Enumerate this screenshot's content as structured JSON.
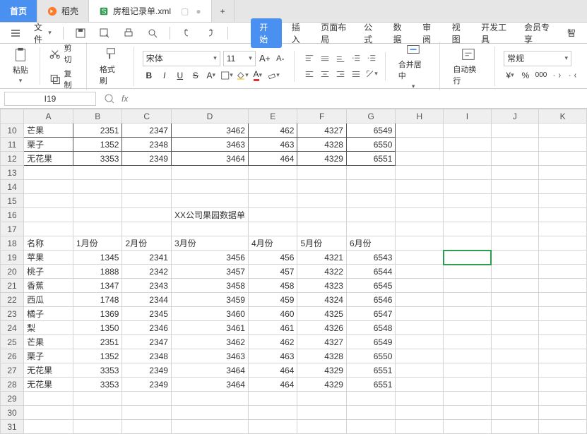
{
  "tabs": {
    "home": "首页",
    "daoke": "稻壳",
    "file": "房租记录单.xml"
  },
  "menu": {
    "file": "文件",
    "start": "开始",
    "insert": "插入",
    "page": "页面布局",
    "formula": "公式",
    "data": "数据",
    "review": "审阅",
    "view": "视图",
    "dev": "开发工具",
    "member": "会员专享",
    "smart": "智"
  },
  "clip": {
    "cut": "剪切",
    "copy": "复制",
    "paste": "粘贴",
    "brush": "格式刷"
  },
  "font": {
    "name": "宋体",
    "size": "11"
  },
  "align": {
    "merge": "合并居中",
    "wrap": "自动换行"
  },
  "numfmt": "常规",
  "cellref": "I19",
  "cols": [
    "A",
    "B",
    "C",
    "D",
    "E",
    "F",
    "G",
    "H",
    "I",
    "J",
    "K"
  ],
  "rows": [
    10,
    11,
    12,
    13,
    14,
    15,
    16,
    17,
    18,
    19,
    20,
    21,
    22,
    23,
    24,
    25,
    26,
    27,
    28,
    29,
    30,
    31
  ],
  "title": "XX公司果园数据单",
  "headers": {
    "name": "名称",
    "m1": "1月份",
    "m2": "2月份",
    "m3": "3月份",
    "m4": "4月份",
    "m5": "5月份",
    "m6": "6月份"
  },
  "top": [
    {
      "name": "芒果",
      "v": [
        2351,
        2347,
        3462,
        462,
        4327,
        6549
      ]
    },
    {
      "name": "栗子",
      "v": [
        1352,
        2348,
        3463,
        463,
        4328,
        6550
      ]
    },
    {
      "name": "无花果",
      "v": [
        3353,
        2349,
        3464,
        464,
        4329,
        6551
      ]
    }
  ],
  "bottom": [
    {
      "name": "苹果",
      "v": [
        1345,
        2341,
        3456,
        456,
        4321,
        6543
      ]
    },
    {
      "name": "桃子",
      "v": [
        1888,
        2342,
        3457,
        457,
        4322,
        6544
      ]
    },
    {
      "name": "香蕉",
      "v": [
        1347,
        2343,
        3458,
        458,
        4323,
        6545
      ]
    },
    {
      "name": "西瓜",
      "v": [
        1748,
        2344,
        3459,
        459,
        4324,
        6546
      ]
    },
    {
      "name": "橘子",
      "v": [
        1369,
        2345,
        3460,
        460,
        4325,
        6547
      ]
    },
    {
      "name": "梨",
      "v": [
        1350,
        2346,
        3461,
        461,
        4326,
        6548
      ]
    },
    {
      "name": "芒果",
      "v": [
        2351,
        2347,
        3462,
        462,
        4327,
        6549
      ]
    },
    {
      "name": "栗子",
      "v": [
        1352,
        2348,
        3463,
        463,
        4328,
        6550
      ]
    },
    {
      "name": "无花果",
      "v": [
        3353,
        2349,
        3464,
        464,
        4329,
        6551
      ]
    },
    {
      "name": "无花果",
      "v": [
        3353,
        2349,
        3464,
        464,
        4329,
        6551
      ]
    }
  ],
  "chart_data": {
    "type": "table",
    "title": "XX公司果园数据单",
    "columns": [
      "名称",
      "1月份",
      "2月份",
      "3月份",
      "4月份",
      "5月份",
      "6月份"
    ],
    "rows": [
      [
        "苹果",
        1345,
        2341,
        3456,
        456,
        4321,
        6543
      ],
      [
        "桃子",
        1888,
        2342,
        3457,
        457,
        4322,
        6544
      ],
      [
        "香蕉",
        1347,
        2343,
        3458,
        458,
        4323,
        6545
      ],
      [
        "西瓜",
        1748,
        2344,
        3459,
        459,
        4324,
        6546
      ],
      [
        "橘子",
        1369,
        2345,
        3460,
        460,
        4325,
        6547
      ],
      [
        "梨",
        1350,
        2346,
        3461,
        461,
        4326,
        6548
      ],
      [
        "芒果",
        2351,
        2347,
        3462,
        462,
        4327,
        6549
      ],
      [
        "栗子",
        1352,
        2348,
        3463,
        463,
        4328,
        6550
      ],
      [
        "无花果",
        3353,
        2349,
        3464,
        464,
        4329,
        6551
      ],
      [
        "无花果",
        3353,
        2349,
        3464,
        464,
        4329,
        6551
      ]
    ]
  }
}
